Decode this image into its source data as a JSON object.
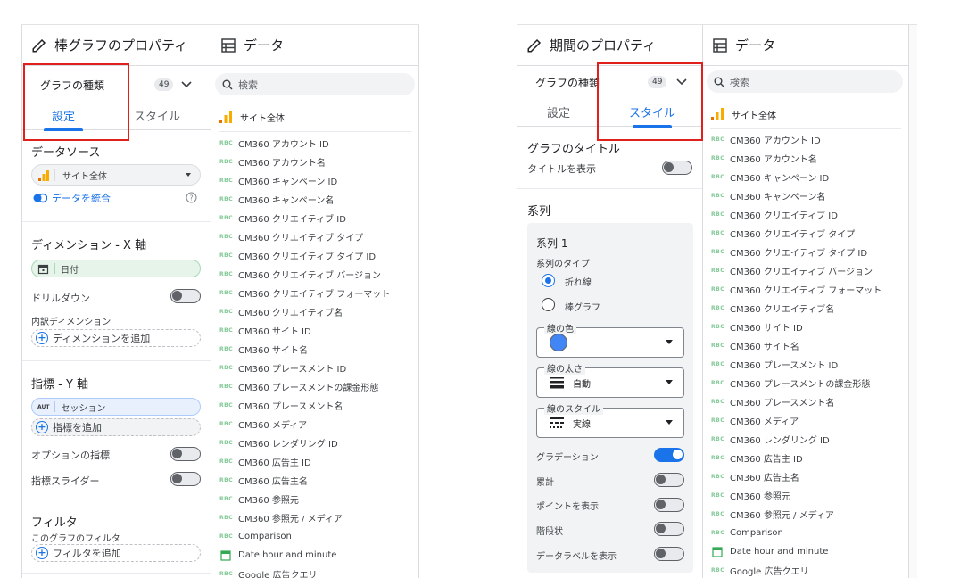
{
  "left_panel_1": {
    "title": "棒グラフのプロパティ",
    "chart_type_label": "グラフの種類",
    "chart_type_badge": "49",
    "tabs": [
      {
        "label": "設定"
      },
      {
        "label": "スタイル"
      }
    ],
    "data_source": {
      "heading": "データソース",
      "value": "サイト全体",
      "blend_label": "データを統合"
    },
    "dimension": {
      "heading": "ディメンション - X 軸",
      "chip": "日付",
      "drilldown_label": "ドリルダウン",
      "breakdown_label": "内訳ディメンション",
      "add_label": "ディメンションを追加"
    },
    "metric": {
      "heading": "指標 - Y 軸",
      "chip": "セッション",
      "chip_prefix": "AUT",
      "add_label": "指標を追加",
      "optional_label": "オプションの指標",
      "slider_label": "指標スライダー"
    },
    "filter": {
      "heading": "フィルタ",
      "sub_label": "このグラフのフィルタ",
      "add_label": "フィルタを追加"
    }
  },
  "data_panel_1": {
    "title": "データ",
    "search_placeholder": "検索",
    "source_name": "サイト全体",
    "fields": [
      {
        "type": "abc",
        "name": "CM360 アカウント ID"
      },
      {
        "type": "abc",
        "name": "CM360 アカウント名"
      },
      {
        "type": "abc",
        "name": "CM360 キャンペーン ID"
      },
      {
        "type": "abc",
        "name": "CM360 キャンペーン名"
      },
      {
        "type": "abc",
        "name": "CM360 クリエイティブ ID"
      },
      {
        "type": "abc",
        "name": "CM360 クリエイティブ タイプ"
      },
      {
        "type": "abc",
        "name": "CM360 クリエイティブ タイプ ID"
      },
      {
        "type": "abc",
        "name": "CM360 クリエイティブ バージョン"
      },
      {
        "type": "abc",
        "name": "CM360 クリエイティブ フォーマット"
      },
      {
        "type": "abc",
        "name": "CM360 クリエイティブ名"
      },
      {
        "type": "abc",
        "name": "CM360 サイト ID"
      },
      {
        "type": "abc",
        "name": "CM360 サイト名"
      },
      {
        "type": "abc",
        "name": "CM360 プレースメント ID"
      },
      {
        "type": "abc",
        "name": "CM360 プレースメントの課金形態"
      },
      {
        "type": "abc",
        "name": "CM360 プレースメント名"
      },
      {
        "type": "abc",
        "name": "CM360 メディア"
      },
      {
        "type": "abc",
        "name": "CM360 レンダリング ID"
      },
      {
        "type": "abc",
        "name": "CM360 広告主 ID"
      },
      {
        "type": "abc",
        "name": "CM360 広告主名"
      },
      {
        "type": "abc",
        "name": "CM360 参照元"
      },
      {
        "type": "abc",
        "name": "CM360 参照元 / メディア"
      },
      {
        "type": "abc",
        "name": "Comparison"
      },
      {
        "type": "date",
        "name": "Date hour and minute"
      },
      {
        "type": "abc",
        "name": "Google 広告クエリ"
      }
    ]
  },
  "left_panel_2": {
    "title": "期間のプロパティ",
    "chart_type_label": "グラフの種類",
    "chart_type_badge": "49",
    "tabs": [
      {
        "label": "設定"
      },
      {
        "label": "スタイル"
      }
    ],
    "chart_title": {
      "heading": "グラフのタイトル",
      "show_label": "タイトルを表示"
    },
    "series": {
      "heading": "系列",
      "card_title": "系列 1",
      "type_label": "系列のタイプ",
      "option_line": "折れ線",
      "option_bar": "棒グラフ",
      "color_label": "線の色",
      "color_value": "#4285f4",
      "width_label": "線の太さ",
      "width_value": "自動",
      "style_label": "線のスタイル",
      "style_value": "実線",
      "gradient_label": "グラデーション",
      "cumulative_label": "累計",
      "points_label": "ポイントを表示",
      "steps_label": "階段状",
      "data_labels_label": "データラベルを表示"
    }
  },
  "data_panel_2": {
    "title": "データ",
    "search_placeholder": "検索",
    "source_name": "サイト全体"
  },
  "colors": {
    "accent": "#1a73e8",
    "highlight_box": "#e0201a",
    "ga_orange": "#f9ab00"
  }
}
